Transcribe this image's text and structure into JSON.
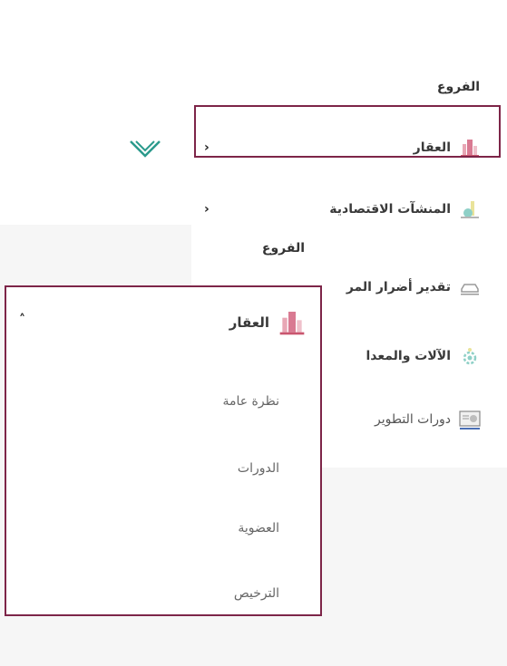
{
  "back_menu": {
    "title": "الفروع",
    "items": [
      {
        "label": "العقار",
        "chevron": "‹",
        "icon": "building-icon"
      },
      {
        "label": "المنشآت الاقتصادية",
        "chevron": "‹",
        "icon": "factory-icon"
      },
      {
        "label": "تقدير أضرار المر",
        "icon": "car-damage-icon"
      },
      {
        "label": "الآلات والمعدا",
        "icon": "machinery-icon"
      },
      {
        "label": "دورات التطوير",
        "icon": "certificate-icon"
      }
    ]
  },
  "expanded_menu": {
    "title": "الفروع",
    "header_label": "العقار",
    "collapse_chevron": "˄",
    "subitems": [
      "نظرة عامة",
      "الدورات",
      "العضوية",
      "الترخيص"
    ]
  },
  "colors": {
    "accent": "#7d2548",
    "chevron_teal": "#2a9a8c"
  }
}
